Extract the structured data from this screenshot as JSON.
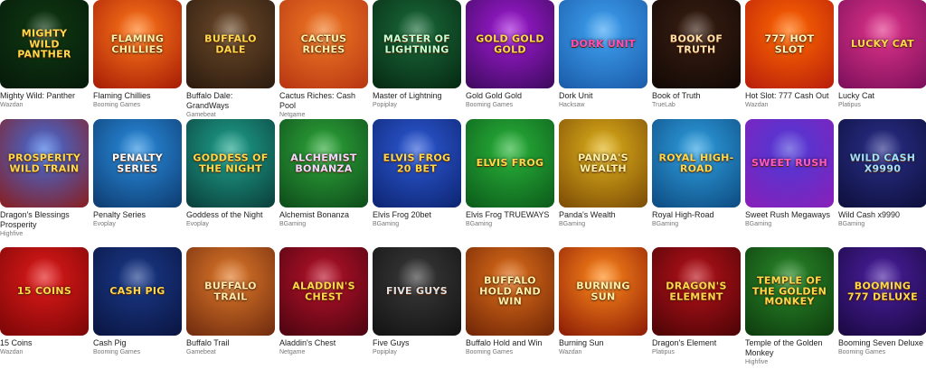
{
  "games": [
    {
      "title": "Mighty Wild: Panther",
      "provider": "Wazdan",
      "art": "Mighty Wild Panther",
      "bg": [
        "#0f3a12",
        "#06190a"
      ],
      "fg": "#ffd84a"
    },
    {
      "title": "Flaming Chillies",
      "provider": "Booming Games",
      "art": "Flaming Chillies",
      "bg": [
        "#ff7a1a",
        "#a51b06"
      ],
      "fg": "#fff1a8"
    },
    {
      "title": "Buffalo Dale: GrandWays",
      "provider": "Gamebeat",
      "art": "Buffalo Dale",
      "bg": [
        "#6d4a2a",
        "#2a1a0e"
      ],
      "fg": "#ffd84a"
    },
    {
      "title": "Cactus Riches: Cash Pool",
      "provider": "Netgame",
      "art": "Cactus Riches",
      "bg": [
        "#f07a25",
        "#b73512"
      ],
      "fg": "#fff1a8"
    },
    {
      "title": "Master of Lightning",
      "provider": "Popiplay",
      "art": "Master of Lightning",
      "bg": [
        "#1a6b3a",
        "#062812"
      ],
      "fg": "#c7ffd1"
    },
    {
      "title": "Gold Gold Gold",
      "provider": "Booming Games",
      "art": "Gold Gold Gold",
      "bg": [
        "#a21bd6",
        "#3c0a5c"
      ],
      "fg": "#ffd84a"
    },
    {
      "title": "Dork Unit",
      "provider": "Hacksaw",
      "art": "Dork Unit",
      "bg": [
        "#3fa3f2",
        "#1a5aa8"
      ],
      "fg": "#ff4fb0"
    },
    {
      "title": "Book of Truth",
      "provider": "TrueLab",
      "art": "Book of Truth",
      "bg": [
        "#3a1f12",
        "#120805"
      ],
      "fg": "#ffe0a8"
    },
    {
      "title": "Hot Slot: 777 Cash Out",
      "provider": "Wazdan",
      "art": "777 Hot Slot",
      "bg": [
        "#ff6a00",
        "#b81d0b"
      ],
      "fg": "#fff6c0"
    },
    {
      "title": "Lucky Cat",
      "provider": "Platipus",
      "art": "Lucky Cat",
      "bg": [
        "#e0338a",
        "#7a0f5a"
      ],
      "fg": "#ffd84a"
    },
    {
      "title": "Dragon's Blessings Prosperity",
      "provider": "Highfive",
      "art": "Prosperity Wild Train",
      "bg": [
        "#3d6fe0",
        "#8a1d1d"
      ],
      "fg": "#ffd84a"
    },
    {
      "title": "Penalty Series",
      "provider": "Evoplay",
      "art": "Penalty Series",
      "bg": [
        "#2a8ee0",
        "#0d3a6e"
      ],
      "fg": "#ffffff"
    },
    {
      "title": "Goddess of the Night",
      "provider": "Evoplay",
      "art": "Goddess of the Night",
      "bg": [
        "#1fa38d",
        "#0a3d3a"
      ],
      "fg": "#ffd84a"
    },
    {
      "title": "Alchemist Bonanza",
      "provider": "BGaming",
      "art": "Alchemist Bonanza",
      "bg": [
        "#2fa83a",
        "#0d4a1a"
      ],
      "fg": "#f3d8ff"
    },
    {
      "title": "Elvis Frog 20bet",
      "provider": "BGaming",
      "art": "Elvis Frog 20 Bet",
      "bg": [
        "#2d5ad6",
        "#0d2470"
      ],
      "fg": "#ffd84a"
    },
    {
      "title": "Elvis Frog TRUEWAYS",
      "provider": "BGaming",
      "art": "Elvis Frog",
      "bg": [
        "#2ab33a",
        "#0b5a1a"
      ],
      "fg": "#ffd84a"
    },
    {
      "title": "Panda's Wealth",
      "provider": "BGaming",
      "art": "Panda's Wealth",
      "bg": [
        "#e0b21a",
        "#7a4a06"
      ],
      "fg": "#fff1a8"
    },
    {
      "title": "Royal High-Road",
      "provider": "BGaming",
      "art": "Royal High-Road",
      "bg": [
        "#2fa0e0",
        "#0d4a80"
      ],
      "fg": "#ffd84a"
    },
    {
      "title": "Sweet Rush Megaways",
      "provider": "BGaming",
      "art": "Sweet Rush",
      "bg": [
        "#4a3ad6",
        "#8a1fb8"
      ],
      "fg": "#ff5ac4"
    },
    {
      "title": "Wild Cash x9990",
      "provider": "BGaming",
      "art": "Wild Cash x9990",
      "bg": [
        "#2a2f8a",
        "#0d0f3a"
      ],
      "fg": "#9fe0ff"
    },
    {
      "title": "15 Coins",
      "provider": "Wazdan",
      "art": "15 Coins",
      "bg": [
        "#e01a1a",
        "#7a0606"
      ],
      "fg": "#ffd84a"
    },
    {
      "title": "Cash Pig",
      "provider": "Booming Games",
      "art": "Cash Pig",
      "bg": [
        "#1a3a8a",
        "#0a1440"
      ],
      "fg": "#ffd84a"
    },
    {
      "title": "Buffalo Trail",
      "provider": "Gamebeat",
      "art": "Buffalo Trail",
      "bg": [
        "#e07a2a",
        "#6e2a0e"
      ],
      "fg": "#ffe8a8"
    },
    {
      "title": "Aladdin's Chest",
      "provider": "Netgame",
      "art": "Aladdin's Chest",
      "bg": [
        "#b8122a",
        "#4a0410"
      ],
      "fg": "#ffd84a"
    },
    {
      "title": "Five Guys",
      "provider": "Popiplay",
      "art": "Five Guys",
      "bg": [
        "#3a3a3a",
        "#121212"
      ],
      "fg": "#e0e0e0"
    },
    {
      "title": "Buffalo Hold and Win",
      "provider": "Booming Games",
      "art": "Buffalo Hold and Win",
      "bg": [
        "#e0701a",
        "#6e2406"
      ],
      "fg": "#fff1a8"
    },
    {
      "title": "Burning Sun",
      "provider": "Wazdan",
      "art": "Burning Sun",
      "bg": [
        "#ff8a1a",
        "#8a1a06"
      ],
      "fg": "#fff1a8"
    },
    {
      "title": "Dragon's Element",
      "provider": "Platipus",
      "art": "Dragon's Element",
      "bg": [
        "#b8121a",
        "#4a0406"
      ],
      "fg": "#ffd84a"
    },
    {
      "title": "Temple of the Golden Monkey",
      "provider": "Highfive",
      "art": "Temple of the Golden Monkey",
      "bg": [
        "#2a8a2a",
        "#0d3a0d"
      ],
      "fg": "#ffd84a"
    },
    {
      "title": "Booming Seven Deluxe",
      "provider": "Booming Games",
      "art": "Booming 777 Deluxe",
      "bg": [
        "#4a1fa0",
        "#1a0840"
      ],
      "fg": "#ffd84a"
    }
  ]
}
